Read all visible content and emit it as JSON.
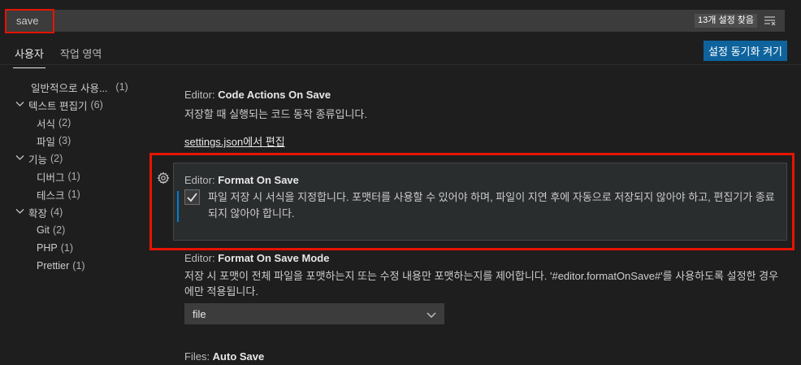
{
  "search": {
    "value": "save",
    "result_count": "13개 설정 찾음",
    "clear_icon": "clear-filter-icon"
  },
  "tabs": [
    {
      "label": "사용자",
      "active": true
    },
    {
      "label": "작업 영역",
      "active": false
    }
  ],
  "sync_button_label": "설정 동기화 켜기",
  "toc": [
    {
      "label": "일반적으로 사용...",
      "count": "(1)",
      "expandable": false,
      "indent": 1
    },
    {
      "label": "텍스트 편집기",
      "count": "(6)",
      "expandable": true,
      "indent": 0
    },
    {
      "label": "서식",
      "count": "(2)",
      "expandable": false,
      "indent": 2
    },
    {
      "label": "파일",
      "count": "(3)",
      "expandable": false,
      "indent": 2
    },
    {
      "label": "기능",
      "count": "(2)",
      "expandable": true,
      "indent": 0
    },
    {
      "label": "디버그",
      "count": "(1)",
      "expandable": false,
      "indent": 2
    },
    {
      "label": "테스크",
      "count": "(1)",
      "expandable": false,
      "indent": 2
    },
    {
      "label": "확장",
      "count": "(4)",
      "expandable": true,
      "indent": 0
    },
    {
      "label": "Git",
      "count": "(2)",
      "expandable": false,
      "indent": 2
    },
    {
      "label": "PHP",
      "count": "(1)",
      "expandable": false,
      "indent": 2
    },
    {
      "label": "Prettier",
      "count": "(1)",
      "expandable": false,
      "indent": 2
    }
  ],
  "settings": {
    "code_actions": {
      "category": "Editor: ",
      "key": "Code Actions On Save",
      "description": "저장할 때 실행되는 코드 동작 종류입니다.",
      "link": "settings.json에서 편집"
    },
    "format_on_save": {
      "category": "Editor: ",
      "key": "Format On Save",
      "description": "파일 저장 시 서식을 지정합니다. 포맷터를 사용할 수 있어야 하며, 파일이 지연 후에 자동으로 저장되지 않아야 하고, 편집기가 종료되지 않아야 합니다.",
      "checked": true
    },
    "format_on_save_mode": {
      "category": "Editor: ",
      "key": "Format On Save Mode",
      "description": "저장 시 포맷이 전체 파일을 포맷하는지 또는 수정 내용만 포맷하는지를 제어합니다. '#editor.formatOnSave#'를 사용하도록 설정한 경우에만 적용됩니다.",
      "value": "file"
    },
    "auto_save": {
      "category": "Files: ",
      "key": "Auto Save"
    }
  },
  "colors": {
    "accent": "#0e639c",
    "focus_bar": "#007fd4",
    "annotation_red": "#e51400"
  }
}
